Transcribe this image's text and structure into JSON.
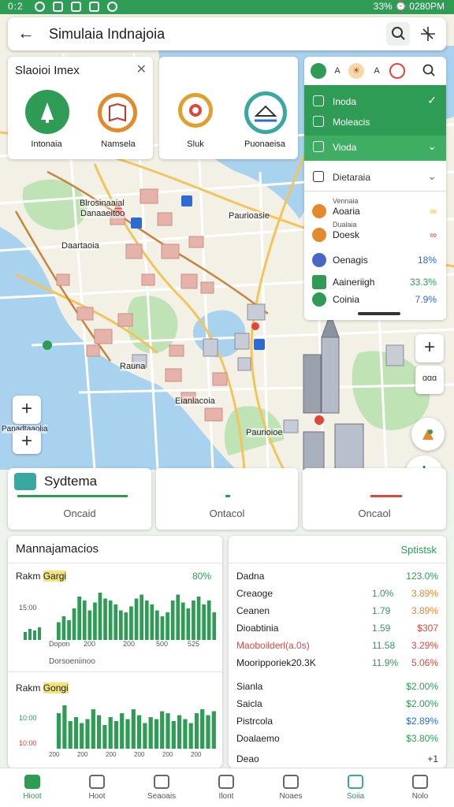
{
  "status_bar": {
    "left": "0:2",
    "right": "33% ⌚ 0280PM"
  },
  "header": {
    "title": "Simulaia Indnajoia"
  },
  "station_card": {
    "title": "Slaoioi Imex",
    "items": [
      {
        "label": "Intonaia",
        "color": "#2e9c55"
      },
      {
        "label": "Namsela",
        "color": "#e38a2c"
      },
      {
        "label": "Sluk",
        "color": "#e0a030"
      },
      {
        "label": "Puonaeisa",
        "color": "#3aa8a0"
      }
    ]
  },
  "filters": {
    "chips": [
      "",
      "A",
      "☀",
      "A",
      ""
    ],
    "rows": [
      {
        "label": "Inoda",
        "checked": true
      },
      {
        "label": "Moleacis",
        "checked": false
      },
      {
        "label": "Vioda",
        "checked": true
      },
      {
        "label": "Dietaraia",
        "checked": false
      }
    ],
    "legend": [
      {
        "sub": "Vennaia",
        "name": "Aoaria",
        "value": "",
        "color": "#e38a2c"
      },
      {
        "sub": "Dualaia",
        "name": "Doesk",
        "value": "",
        "color": "#e38a2c"
      },
      {
        "sub": "",
        "name": "Oenagis",
        "value": "18%",
        "color": "#4a66c4"
      },
      {
        "sub": "",
        "name": "Aaineriigh",
        "value": "33.3%",
        "color": "#2e9c55"
      },
      {
        "sub": "",
        "name": "Coinia",
        "value": "7.9%",
        "color": "#2e9c55"
      }
    ]
  },
  "map_labels": {
    "a": "Blrosinaaial",
    "b": "Danaaeitoo",
    "c": "Paurioasie",
    "d": "Daartaoia",
    "e": "Rauna",
    "f": "Eianlacoia",
    "g": "Paurioioe",
    "h": "Panadtaaolia"
  },
  "map_controls": {
    "zoom_in": "+",
    "zoom_in2": "+",
    "scale": "ɑɑɑ",
    "add": "+"
  },
  "system": {
    "title": "Sydtema",
    "cards": [
      {
        "value": "Oncaid",
        "color": "#2e9c55"
      },
      {
        "value": "Ontacol",
        "color": "#2e9c55"
      },
      {
        "value": "Oncaol",
        "color": "#e0463a"
      }
    ]
  },
  "panel_left": {
    "title": "Mannajamacios",
    "chart1": {
      "label": "Rakm",
      "label_hl": "Gargi",
      "percent": "80%",
      "y_tick": "15:00",
      "x_ticks": [
        "Dopon",
        "200",
        "200",
        "500",
        "525"
      ],
      "x_label": "Dorsoeniinoo"
    },
    "chart2": {
      "label": "Rakm",
      "label_hl": "Gongi",
      "y_tick_green": "10:00",
      "y_tick_red": "10:00",
      "x_ticks": [
        "200",
        "200",
        "200",
        "200",
        "200",
        "200"
      ]
    }
  },
  "chart_data": [
    {
      "type": "bar",
      "series": [
        {
          "values": [
            9,
            12,
            10,
            16,
            22,
            20,
            15,
            19,
            24,
            21,
            20,
            18,
            15,
            14,
            17,
            21,
            23,
            20,
            18,
            15,
            12,
            14,
            20,
            23,
            19,
            16,
            20,
            22,
            18,
            20,
            14
          ]
        }
      ],
      "ylim": [
        0,
        28
      ]
    },
    {
      "type": "bar",
      "series": [
        {
          "values": [
            18,
            22,
            14,
            16,
            13,
            15,
            20,
            17,
            12,
            16,
            14,
            18,
            15,
            20,
            17,
            13,
            16,
            15,
            19,
            18,
            14,
            17,
            15,
            13,
            18,
            20,
            17,
            19
          ]
        }
      ],
      "ylim": [
        0,
        24
      ]
    }
  ],
  "panel_right": {
    "title": "Sptistsk",
    "rows": [
      {
        "a": "Dadna",
        "b": "",
        "c": "123.0%"
      },
      {
        "a": "Creaoge",
        "b": "1.0%",
        "c": "3.89%"
      },
      {
        "a": "Ceanen",
        "b": "1.79",
        "c": "3.89%"
      },
      {
        "a": "Dioabtinia",
        "b": "1.59",
        "c": "$307"
      },
      {
        "a": "Maoboilderl(a.0s)",
        "b": "11.58",
        "c": "3.29%"
      },
      {
        "a": "Mooripporiek20.3K",
        "b": "11.9%",
        "c": "5.06%"
      },
      {
        "a": "Sianla",
        "b": "",
        "c": "$2.00%"
      },
      {
        "a": "Saicla",
        "b": "",
        "c": "$2.00%"
      },
      {
        "a": "Pistrcola",
        "b": "",
        "c": "$2.89%"
      },
      {
        "a": "Doalaemo",
        "b": "",
        "c": "$3.80%"
      },
      {
        "a": "Deao",
        "b": "",
        "c": "+1"
      }
    ]
  },
  "nav": [
    {
      "label": "Hioot",
      "active": true
    },
    {
      "label": "Hoot",
      "active": false
    },
    {
      "label": "Seaoais",
      "active": false
    },
    {
      "label": "Ilont",
      "active": false
    },
    {
      "label": "Noaes",
      "active": false
    },
    {
      "label": "Soiia",
      "active": false
    },
    {
      "label": "Nolo",
      "active": false
    }
  ],
  "colors": {
    "accent": "#2e9c55",
    "red": "#e0463a",
    "orange": "#e38a2c",
    "yellow": "#e7c21c"
  }
}
